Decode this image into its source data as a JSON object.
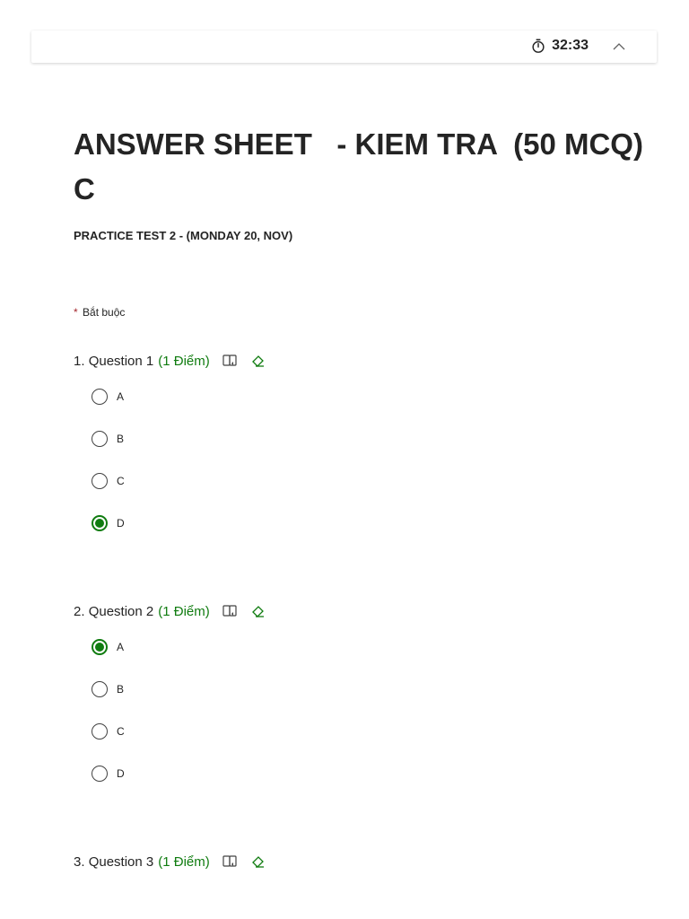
{
  "header": {
    "timer": "32:33",
    "icons": {
      "timer": "stopwatch-icon",
      "collapse": "chevron-up-icon"
    }
  },
  "form": {
    "title": "ANSWER SHEET   - KIEM TRA  (50 MCQ) C",
    "subtitle": "PRACTICE TEST 2 - (MONDAY 20, NOV)",
    "required_mark": "*",
    "required_label": "Bắt buộc"
  },
  "colors": {
    "accent": "#107c10",
    "required": "#a4262c",
    "text": "#242424"
  },
  "questions": [
    {
      "number": "1.",
      "label": "Question 1",
      "points": "(1 Điểm)",
      "options": [
        "A",
        "B",
        "C",
        "D"
      ],
      "selected": "D"
    },
    {
      "number": "2.",
      "label": "Question 2",
      "points": "(1 Điểm)",
      "options": [
        "A",
        "B",
        "C",
        "D"
      ],
      "selected": "A"
    },
    {
      "number": "3.",
      "label": "Question 3",
      "points": "(1 Điểm)",
      "options": [],
      "selected": null
    }
  ]
}
